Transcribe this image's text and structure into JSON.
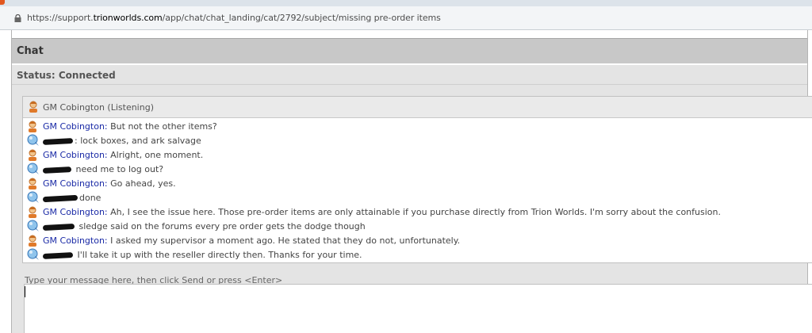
{
  "browser": {
    "url_prefix": "https://support.",
    "url_domain": "trionworlds.com",
    "url_path": "/app/chat/chat_landing/cat/2792/subject/missing pre-order items",
    "icons": {
      "secure": "lock-icon",
      "gm": "gm-person-icon",
      "user": "user-bubble-icon"
    }
  },
  "chat": {
    "title": "Chat",
    "status": "Status: Connected",
    "listening": "GM Cobington (Listening)",
    "messages": [
      {
        "speaker": "gm",
        "name": "GM Cobington:",
        "text": " But not the other items?"
      },
      {
        "speaker": "user",
        "name": "",
        "text": ": lock boxes, and ark salvage"
      },
      {
        "speaker": "gm",
        "name": "GM Cobington:",
        "text": " Alright, one moment."
      },
      {
        "speaker": "user",
        "name": "",
        "text": " need me to log out?"
      },
      {
        "speaker": "gm",
        "name": "GM Cobington:",
        "text": " Go ahead, yes."
      },
      {
        "speaker": "user",
        "name": "",
        "text": "done"
      },
      {
        "speaker": "gm",
        "name": "GM Cobington:",
        "text": " Ah, I see the issue here. Those pre-order items are only attainable if you purchase directly from Trion Worlds. I'm sorry about the confusion."
      },
      {
        "speaker": "user",
        "name": "",
        "text": " sledge said on the forums every pre order gets the dodge though"
      },
      {
        "speaker": "gm",
        "name": "GM Cobington:",
        "text": " I asked my supervisor a moment ago. He stated that they do not, unfortunately."
      },
      {
        "speaker": "user",
        "name": "",
        "text": " I'll take it up with the reseller directly then.  Thanks for your time."
      }
    ],
    "input_hint": "Type your message here, then click Send or press <Enter>",
    "input_value": ""
  },
  "colors": {
    "speaker_name": "#1a2aa6",
    "header_bg": "#c8c8c8",
    "panel_bg": "#e4e4e4"
  }
}
